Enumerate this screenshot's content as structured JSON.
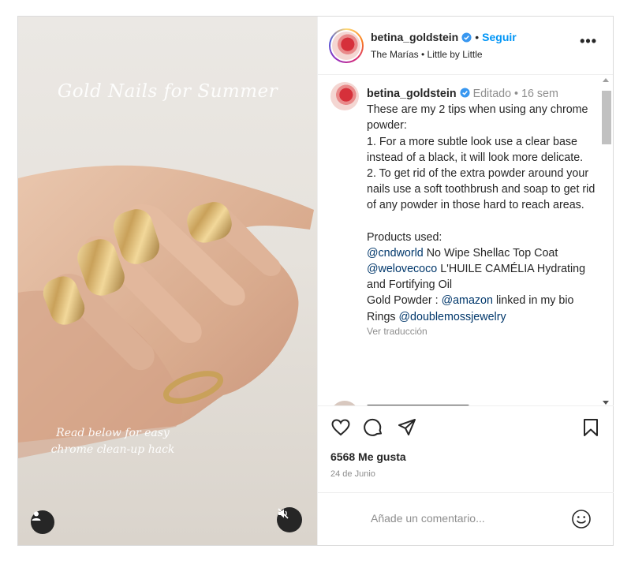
{
  "media": {
    "title": "Gold Nails for Summer",
    "caption": "Read below for easy chrome clean-up hack",
    "user_tag_icon": "user-icon",
    "mute_icon": "muted-speaker-icon"
  },
  "header": {
    "username": "betina_goldstein",
    "separator": "•",
    "follow_label": "Seguir",
    "song": "The Marías • Little by Little",
    "more_label": "•••"
  },
  "comment": {
    "username": "betina_goldstein",
    "meta": "Editado • 16 sem",
    "intro": "These are my 2 tips when using any chrome powder:",
    "tip1": "1. For a more subtle look use a clear base instead of a black, it will look more delicate.",
    "tip2": "2. To get rid of the extra powder around your nails use a soft toothbrush and soap to get rid of any powder in those hard to reach areas.",
    "products_heading": "Products used:",
    "p1_mention": "@cndworld",
    "p1_text": " No Wipe Shellac Top Coat",
    "p2_mention": "@welovecoco",
    "p2_text": " L'HUILE CAMÉLIA Hydrating and Fortifying Oil",
    "p3_prefix": "Gold Powder : ",
    "p3_mention": "@amazon",
    "p3_text": " linked in my bio",
    "p4_prefix": "Rings ",
    "p4_mention": "@doublemossjewelry",
    "translate_label": "Ver traducción"
  },
  "actions": {
    "likes": "6568 Me gusta",
    "date": "24 de Junio"
  },
  "composer": {
    "placeholder": "Añade un comentario..."
  },
  "colors": {
    "accent": "#0095f6",
    "mention": "#00376b",
    "verified": "#3897f0"
  }
}
